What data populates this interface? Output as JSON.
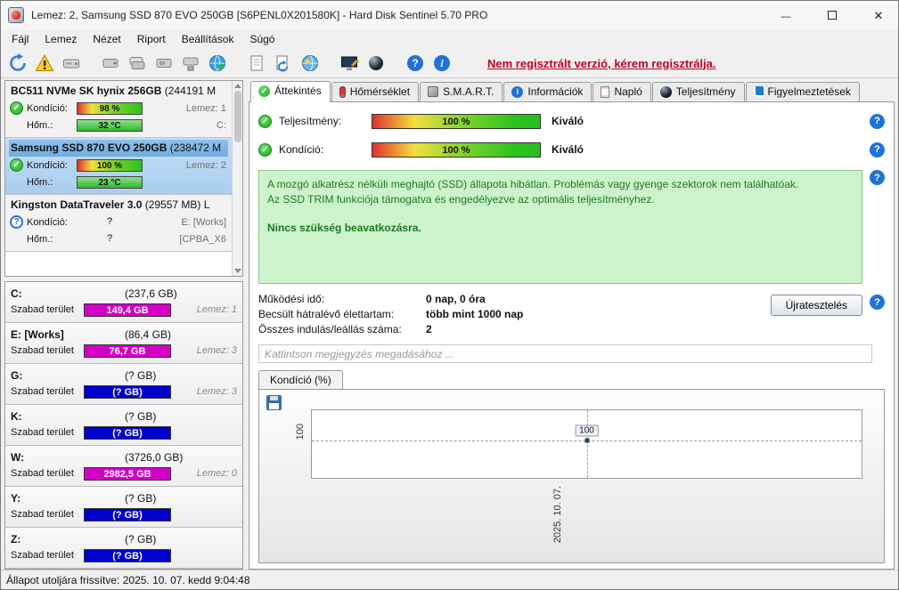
{
  "window": {
    "title": "Lemez: 2, Samsung SSD 870 EVO 250GB [S6PENL0X201580K]  -  Hard Disk Sentinel 5.70 PRO"
  },
  "menu": [
    "Fájl",
    "Lemez",
    "Nézet",
    "Riport",
    "Beállítások",
    "Súgó"
  ],
  "toolbar": {
    "icons": [
      "refresh-icon",
      "warning-icon",
      "disk-eject-icon",
      "disk-scan-icon",
      "disk-copy-icon",
      "disk-usb-icon",
      "disk-network-icon",
      "globe-icon",
      "report-icon",
      "report-refresh-icon",
      "web-icon",
      "monitor-edit-icon",
      "gauge-icon",
      "help-icon",
      "info-icon"
    ],
    "register_link": "Nem regisztrált verzió, kérem regisztrálja."
  },
  "tabs": [
    "Áttekintés",
    "Hőmérséklet",
    "S.M.A.R.T.",
    "Információk",
    "Napló",
    "Teljesítmény",
    "Figyelmeztetések"
  ],
  "sidebar": {
    "condition_label": "Kondíció:",
    "temp_label": "Hőm.:",
    "free_label": "Szabad terület",
    "disks": [
      {
        "name": "BC511 NVMe SK hynix 256GB",
        "size": "(244191 M",
        "status": "ok",
        "condition": "98 %",
        "right1": "Lemez: 1",
        "temp": "32 °C",
        "right2": "C:"
      },
      {
        "name": "Samsung SSD 870 EVO 250GB",
        "size": "(238472 M",
        "status": "ok",
        "selected": true,
        "condition": "100 %",
        "right1": "Lemez: 2",
        "temp": "23 °C",
        "right2": ""
      },
      {
        "name": "Kingston DataTraveler 3.0",
        "size": "(29557 MB) L",
        "status": "unknown",
        "condition": "?",
        "right1": "E: [Works]",
        "temp": "?",
        "right2": "[CPBA_X6"
      }
    ],
    "partitions": [
      {
        "letter": "C:",
        "size": "(237,6 GB)",
        "free": "149,4 GB",
        "right": "Lemez: 1",
        "bar_color": "#d400c8"
      },
      {
        "letter": "E: [Works]",
        "size": "(86,4 GB)",
        "free": "76,7 GB",
        "right": "Lemez: 3",
        "bar_color": "#d400c8"
      },
      {
        "letter": "G:",
        "size": "(? GB)",
        "free": "(? GB)",
        "right": "Lemez: 3",
        "bar_color": "#0000cc"
      },
      {
        "letter": "K:",
        "size": "(? GB)",
        "free": "(? GB)",
        "right": "",
        "bar_color": "#0000cc"
      },
      {
        "letter": "W:",
        "size": "(3726,0 GB)",
        "free": "2982,5 GB",
        "right": "Lemez: 0",
        "bar_color": "#d400c8"
      },
      {
        "letter": "Y:",
        "size": "(? GB)",
        "free": "(? GB)",
        "right": "",
        "bar_color": "#0000cc"
      },
      {
        "letter": "Z:",
        "size": "(? GB)",
        "free": "(? GB)",
        "right": "",
        "bar_color": "#0000cc"
      }
    ]
  },
  "overview": {
    "performance_label": "Teljesítmény:",
    "performance_value": "100 %",
    "performance_rating": "Kiváló",
    "condition_label": "Kondíció:",
    "condition_value": "100 %",
    "condition_rating": "Kiváló",
    "description": {
      "line1": "A mozgó alkatrész nélküli meghajtó (SSD) állapota hibátlan. Problémás vagy gyenge szektorok nem találhatóak.",
      "line2": "Az SSD TRIM funkciója támogatva és engedélyezve az optimális teljesítményhez.",
      "bold": "Nincs szükség beavatkozásra."
    },
    "stats": [
      {
        "label": "Működési idő:",
        "value": "0 nap, 0 óra"
      },
      {
        "label": "Becsült hátralévő élettartam:",
        "value": "több mint 1000 nap"
      },
      {
        "label": "Összes indulás/leállás száma:",
        "value": "2"
      }
    ],
    "retest_button": "Újratesztelés",
    "comment_placeholder": "Kattintson megjegyzés megadásához ..."
  },
  "chart": {
    "tab_label": "Kondíció  (%)",
    "y_tick": "100",
    "point_label": "100",
    "x_tick": "2025. 10. 07."
  },
  "chart_data": {
    "type": "line",
    "title": "Kondíció (%)",
    "x": [
      "2025. 10. 07."
    ],
    "values": [
      100
    ],
    "ylabel": "Kondíció (%)",
    "y_ticks": [
      100
    ],
    "grid": "dashed",
    "legend": "none"
  },
  "status_bar": "Állapot utoljára frissítve: 2025. 10. 07. kedd 9:04:48"
}
